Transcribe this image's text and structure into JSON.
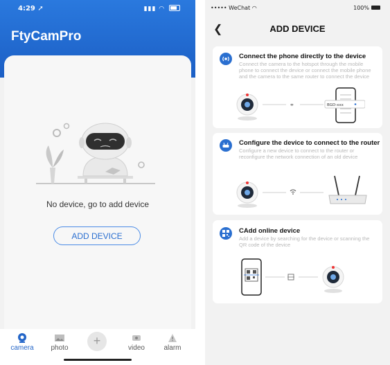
{
  "left_phone": {
    "status_time": "4:29",
    "app_title": "FtyCamPro",
    "empty_message": "No device, go to add device",
    "add_device_button": "ADD DEVICE",
    "tabs": [
      {
        "label": "camera",
        "icon": "camera-icon",
        "active": true
      },
      {
        "label": "photo",
        "icon": "photo-icon",
        "active": false
      },
      {
        "label": "video",
        "icon": "video-icon",
        "active": false
      },
      {
        "label": "alarm",
        "icon": "alarm-icon",
        "active": false
      }
    ],
    "center_button": "+"
  },
  "right_phone": {
    "status_carrier": "••••• WeChat",
    "status_battery": "100%",
    "nav_title": "ADD DEVICE",
    "options": [
      {
        "title": "Connect the phone directly to the device",
        "description": "Connect the camera to the hotspot through the mobile phone to connect the device or connect the mobile phone and the camera to the same router to connect the device",
        "icon": "hotspot-icon",
        "phone_ssid": "BGD-xxx"
      },
      {
        "title": "Configure the device to connect to the router",
        "description": "Configure a new device to connect to the router or reconfigure the network connection of an old device",
        "icon": "router-icon"
      },
      {
        "title": "CAdd online device",
        "description": "Add a device by searching for the device or scanning the QR code of the device",
        "icon": "scan-icon"
      }
    ]
  },
  "colors": {
    "brand_blue": "#2a79de",
    "accent_blue": "#2a6fd0",
    "background": "#f2f2f2"
  }
}
